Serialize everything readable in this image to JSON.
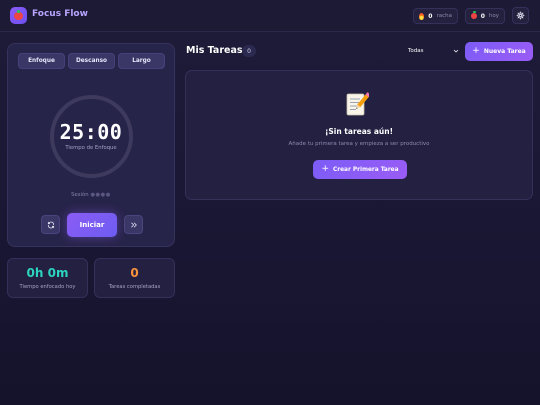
{
  "header": {
    "app_title": "Focus Flow",
    "streak_value": "0",
    "streak_label": "racha",
    "today_value": "0",
    "today_label": "hoy",
    "icons": {
      "logo": "tomato-icon",
      "streak": "flame-icon",
      "today": "tomato-icon",
      "settings": "gear-icon"
    }
  },
  "timer": {
    "modes": [
      {
        "label": "Enfoque"
      },
      {
        "label": "Descanso"
      },
      {
        "label": "Largo"
      }
    ],
    "time": "25:00",
    "time_label": "Tiempo de Enfoque",
    "session_label": "Sesión",
    "session_dots": "●●●●",
    "start_label": "Iniciar"
  },
  "stats": {
    "focused_value": "0h 0m",
    "focused_label": "Tiempo enfocado hoy",
    "done_value": "0",
    "done_label": "Tareas completadas"
  },
  "tasks": {
    "title": "Mis Tareas",
    "count": "0",
    "filter_selected": "Todas",
    "new_task_label": "Nueva Tarea",
    "empty_title": "¡Sin tareas aún!",
    "empty_text": "Añade tu primera tarea y empieza a ser productivo",
    "create_first_label": "Crear Primera Tarea"
  },
  "colors": {
    "accent": "#8b5cf6",
    "focused_stat": "#2dd4bf",
    "done_stat": "#fb923c",
    "background": "#1b1935"
  }
}
